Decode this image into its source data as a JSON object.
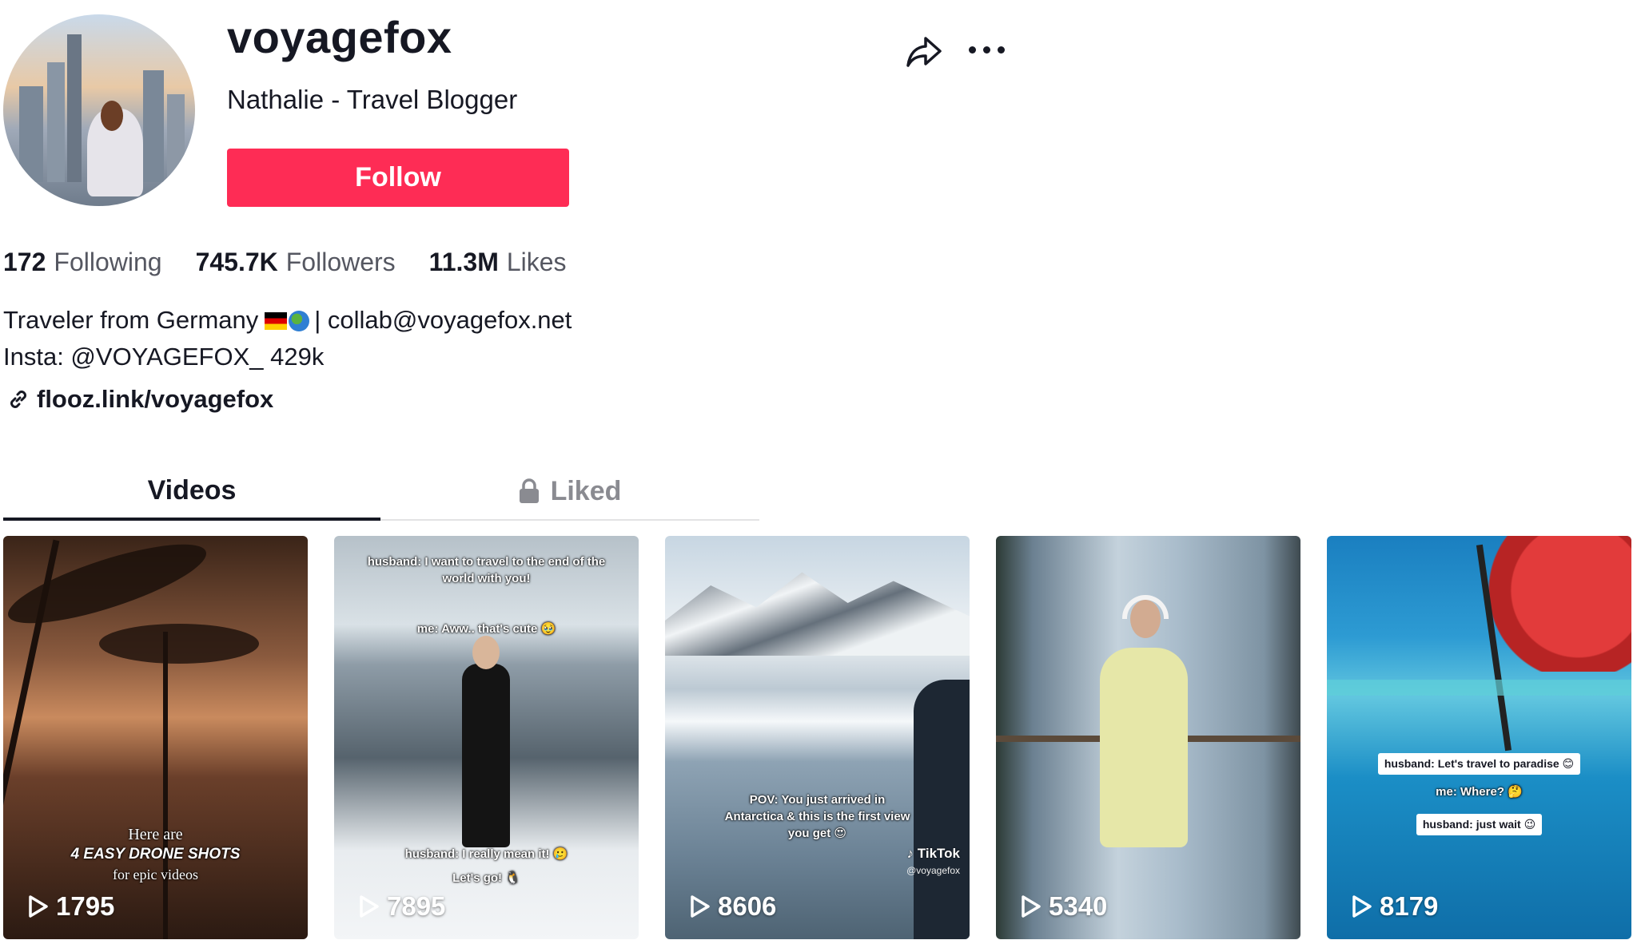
{
  "profile": {
    "username": "voyagefox",
    "nickname": "Nathalie - Travel Blogger",
    "follow_label": "Follow"
  },
  "stats": [
    {
      "value": "172",
      "label": "Following"
    },
    {
      "value": "745.7K",
      "label": "Followers"
    },
    {
      "value": "11.3M",
      "label": "Likes"
    }
  ],
  "bio": {
    "line1_text": "Traveler from Germany",
    "line1_email": "| collab@voyagefox.net",
    "line2": "Insta: @VOYAGEFOX_ 429k",
    "link": "flooz.link/voyagefox"
  },
  "tabs": [
    {
      "label": "Videos",
      "active": true
    },
    {
      "label": "Liked",
      "active": false,
      "icon": "lock-icon"
    }
  ],
  "videos": [
    {
      "views": "1795",
      "overlay": [
        "Here are",
        "4 EASY DRONE SHOTS",
        "for epic videos"
      ]
    },
    {
      "views": "7895",
      "overlay": [
        "husband: I want to travel to the end of the world with you!",
        "me: Aww.. that's cute 🥹",
        "husband: I really mean it! 🥲",
        "Let's go! 🐧"
      ]
    },
    {
      "views": "8606",
      "overlay": [
        "POV: You just arrived in Antarctica & this is the first view you get 😍"
      ],
      "watermark": "TikTok",
      "watermark_handle": "@voyagefox"
    },
    {
      "views": "5340",
      "overlay": []
    },
    {
      "views": "8179",
      "overlay": [
        "husband: Let's travel to paradise 😊",
        "me: Where? 🤔",
        "husband: just wait 😉"
      ]
    }
  ],
  "colors": {
    "follow": "#fe2c55",
    "text": "#161823",
    "muted": "#555761"
  }
}
